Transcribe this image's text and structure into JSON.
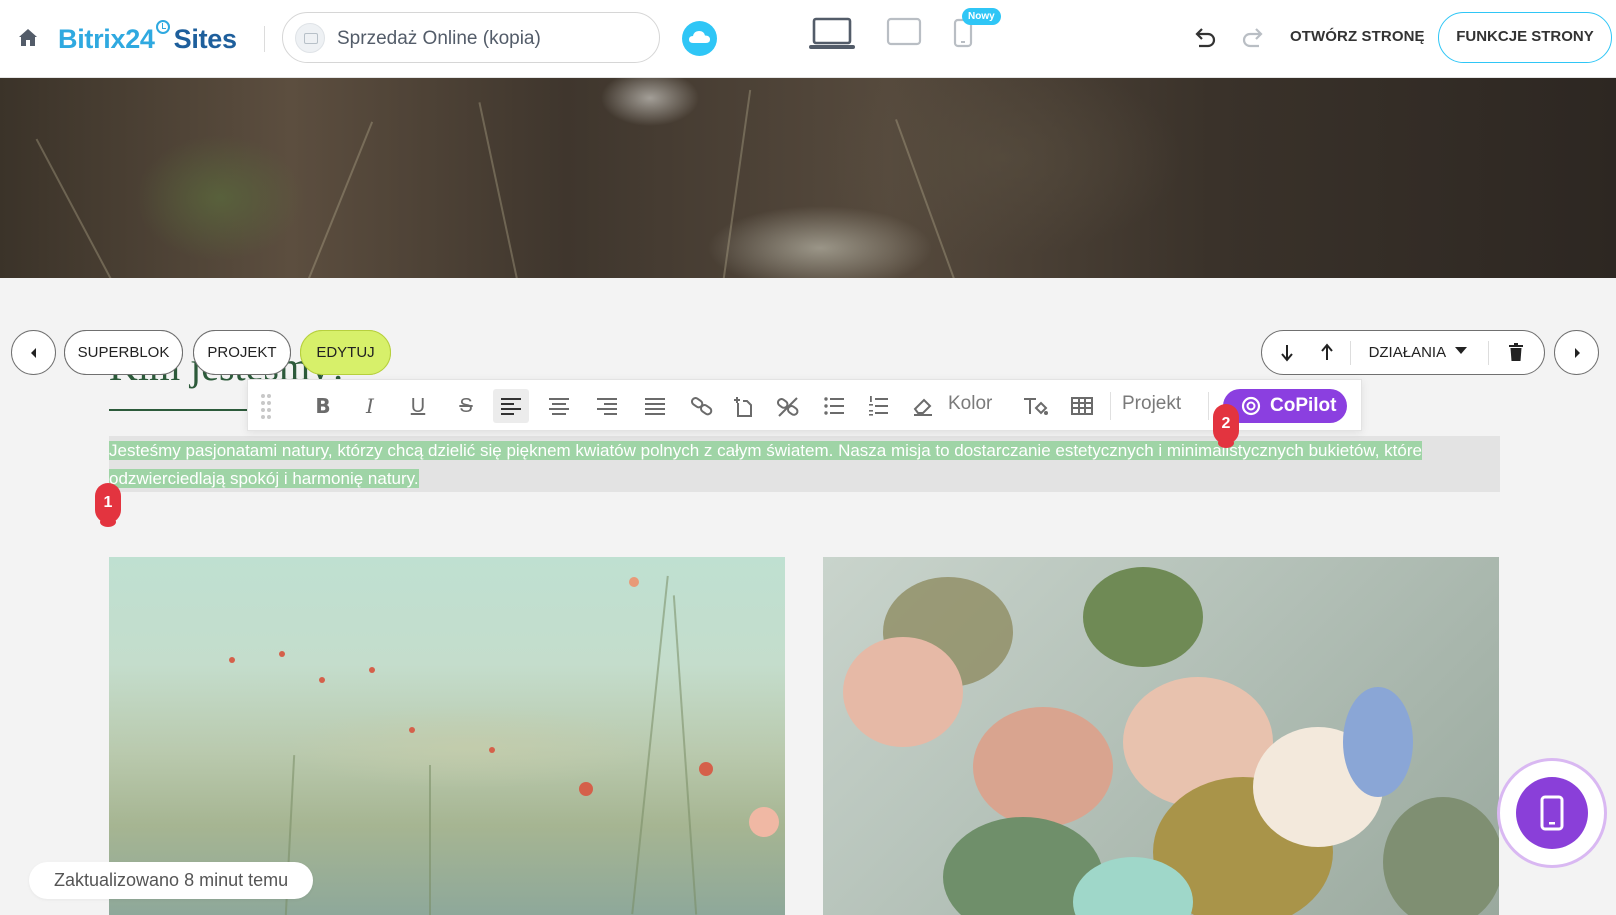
{
  "header": {
    "logo_main": "Bitrix24",
    "logo_suffix": "Sites",
    "site_name": "Sprzedaż Online (kopia)",
    "new_badge": "Nowy",
    "open_page_label": "OTWÓRZ STRONĘ",
    "page_functions_label": "FUNKCJE STRONY",
    "accent_color": "#2fc6f6"
  },
  "block_controls": {
    "superblock_label": "SUPERBLOK",
    "design_label": "PROJEKT",
    "edit_label": "EDYTUJ",
    "actions_label": "DZIAŁANIA"
  },
  "content": {
    "heading": "Kim jesteśmy?",
    "paragraph": "Jesteśmy pasjonatami natury, którzy chcą dzielić się pięknem kwiatów polnych z całym światem. Nasza misja to dostarczanie estetycznych i minimalistycznych bukietów, które odzwierciedlają spokój i harmonię natury."
  },
  "text_toolbar": {
    "color_label": "Kolor",
    "design_label": "Projekt",
    "copilot_label": "CoPilot",
    "copilot_color": "#8b3fe0"
  },
  "markers": {
    "first": "1",
    "second": "2"
  },
  "status": {
    "updated_text": "Zaktualizowano 8 minut temu"
  }
}
